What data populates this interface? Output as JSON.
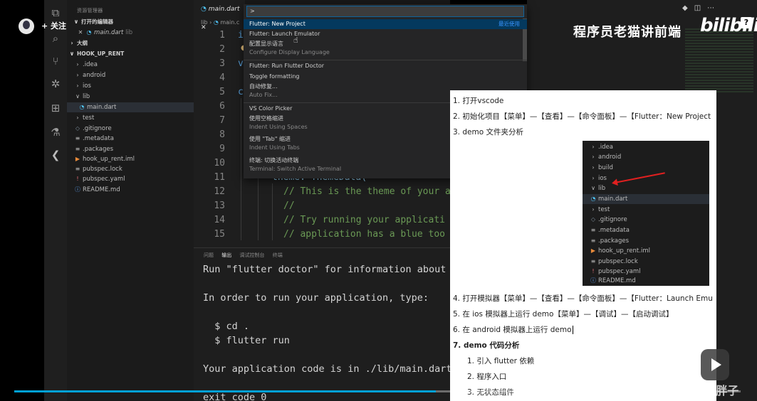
{
  "sidebar": {
    "explorer_title": "资源管理器",
    "open_editors": "打开的编辑器",
    "open_file": "main.dart",
    "open_file_dir": "lib",
    "outline": "大纲",
    "project": "HOOK_UP_RENT",
    "items": [
      ".idea",
      "android",
      "ios",
      "lib",
      "main.dart",
      "test",
      ".gitignore",
      ".metadata",
      ".packages",
      "hook_up_rent.iml",
      "pubspec.lock",
      "pubspec.yaml",
      "README.md"
    ]
  },
  "editor": {
    "tab": "main.dart",
    "crumb_dir": "lib",
    "crumb_file": "main.c",
    "line_numbers": [
      "1",
      "2",
      "3",
      "4",
      "5",
      "6",
      "7",
      "8",
      "9",
      "10",
      "11",
      "12",
      "13",
      "14",
      "15"
    ],
    "code_fragments": {
      "l1": "i",
      "l3": "v",
      "l5": "c",
      "l11": "theme: ThemeData(",
      "l12": "// This is the theme of your a",
      "l13": "//",
      "l14": "// Try running your applicati",
      "l15": "// application has a blue too"
    }
  },
  "panel": {
    "tabs": [
      "问题",
      "输出",
      "调试控制台",
      "终端"
    ],
    "active_tab": "输出",
    "lines": [
      "Run \"flutter doctor\" for information about",
      "In order to run your application, type:",
      "  $ cd .",
      "  $ flutter run",
      "Your application code is in ./lib/main.dart",
      "exit code 0"
    ]
  },
  "palette": {
    "input": ">",
    "recent_tag": "最近使用",
    "items": [
      {
        "label": "Flutter: New Project",
        "sub": ""
      },
      {
        "label": "Flutter: Launch Emulator",
        "sub": ""
      },
      {
        "label": "配置显示语言",
        "sub": "Configure Display Language"
      },
      {
        "label": "Flutter: Run Flutter Doctor",
        "sub": ""
      },
      {
        "label": "Toggle formatting",
        "sub": ""
      },
      {
        "label": "自动修复...",
        "sub": "Auto Fix..."
      },
      {
        "label": "VS Color Picker",
        "sub": ""
      },
      {
        "label": "使用空格缩进",
        "sub": "Indent Using Spaces"
      },
      {
        "label": "使用 \"Tab\" 缩进",
        "sub": "Indent Using Tabs"
      },
      {
        "label": "终端: 切换活动终端",
        "sub": "Terminal: Switch Active Terminal"
      }
    ]
  },
  "overlay": {
    "follow": "+ 关注",
    "brand": "程序员老猫讲前端",
    "bili": "bilibili",
    "qmark": "?",
    "watermark": "CSDN @bst@微胖子",
    "progress_fraction": 0.58
  },
  "doc": {
    "lines": [
      "1. 打开vscode",
      "2. 初始化项目【菜单】—【查看】—【命令面板】—【Flutter：New Project",
      "3. demo 文件夹分析",
      "4. 打开模拟器【菜单】—【查看】—【命令面板】—【Flutter：Launch Emu",
      "5. 在 ios 模拟器上运行 demo【菜单】—【调试】—【启动调试】",
      "6. 在 android 模拟器上运行 demo",
      "7. demo 代码分析"
    ],
    "sub_lines": [
      "1. 引入 flutter 依赖",
      "2. 程序入口",
      "3. 无状态组件"
    ],
    "tree": [
      ".idea",
      "android",
      "build",
      "ios",
      "lib",
      "main.dart",
      "test",
      ".gitignore",
      ".metadata",
      ".packages",
      "hook_up_rent.iml",
      "pubspec.lock",
      "pubspec.yaml",
      "README.md"
    ]
  }
}
